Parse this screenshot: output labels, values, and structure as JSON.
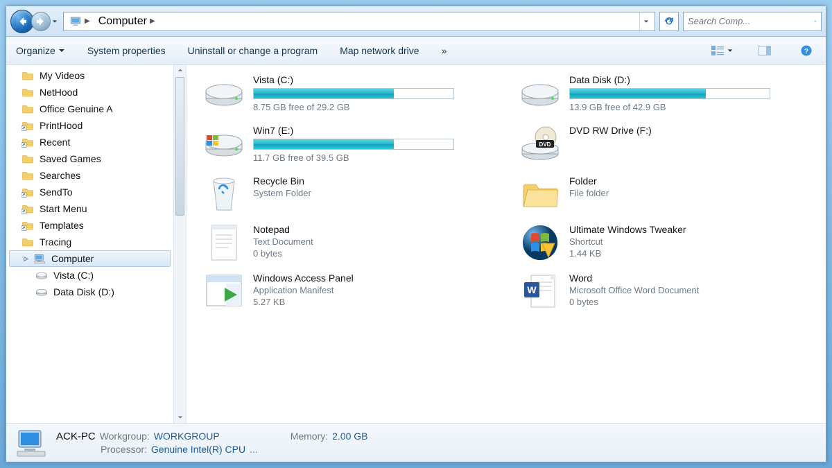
{
  "address": {
    "location": "Computer"
  },
  "search": {
    "placeholder": "Search Comp..."
  },
  "toolbar": {
    "organize": "Organize",
    "system_properties": "System properties",
    "uninstall": "Uninstall or change a program",
    "map_network": "Map network drive",
    "more": "»"
  },
  "sidebar": {
    "items": [
      {
        "label": "My Videos",
        "icon": "folder"
      },
      {
        "label": "NetHood",
        "icon": "folder"
      },
      {
        "label": "Office Genuine A",
        "icon": "folder"
      },
      {
        "label": "PrintHood",
        "icon": "shortcut"
      },
      {
        "label": "Recent",
        "icon": "shortcut"
      },
      {
        "label": "Saved Games",
        "icon": "folder"
      },
      {
        "label": "Searches",
        "icon": "folder"
      },
      {
        "label": "SendTo",
        "icon": "shortcut"
      },
      {
        "label": "Start Menu",
        "icon": "shortcut"
      },
      {
        "label": "Templates",
        "icon": "shortcut"
      },
      {
        "label": "Tracing",
        "icon": "folder"
      }
    ],
    "computer": "Computer",
    "drives": [
      {
        "label": "Vista (C:)"
      },
      {
        "label": "Data Disk (D:)"
      }
    ]
  },
  "content": {
    "drives": [
      {
        "name": "Vista (C:)",
        "free": "8.75 GB free of 29.2 GB",
        "fill_pct": 70
      },
      {
        "name": "Data Disk (D:)",
        "free": "13.9 GB free of 42.9 GB",
        "fill_pct": 68
      },
      {
        "name": "Win7 (E:)",
        "free": "11.7 GB free of 39.5 GB",
        "fill_pct": 70
      }
    ],
    "dvd": {
      "name": "DVD RW Drive (F:)"
    },
    "recycle": {
      "name": "Recycle Bin",
      "sub": "System Folder"
    },
    "folder": {
      "name": "Folder",
      "sub": "File folder"
    },
    "notepad": {
      "name": "Notepad",
      "sub1": "Text Document",
      "sub2": "0 bytes"
    },
    "uwt": {
      "name": "Ultimate Windows  Tweaker",
      "sub1": "Shortcut",
      "sub2": "1.44 KB"
    },
    "wap": {
      "name": "Windows Access Panel",
      "sub1": "Application Manifest",
      "sub2": "5.27 KB"
    },
    "word": {
      "name": "Word",
      "sub1": "Microsoft Office Word Document",
      "sub2": "0 bytes"
    }
  },
  "details": {
    "name": "ACK-PC",
    "workgroup_label": "Workgroup:",
    "workgroup": "WORKGROUP",
    "memory_label": "Memory:",
    "memory": "2.00 GB",
    "processor_label": "Processor:",
    "processor": "Genuine Intel(R) CPU",
    "ellipsis": "..."
  }
}
